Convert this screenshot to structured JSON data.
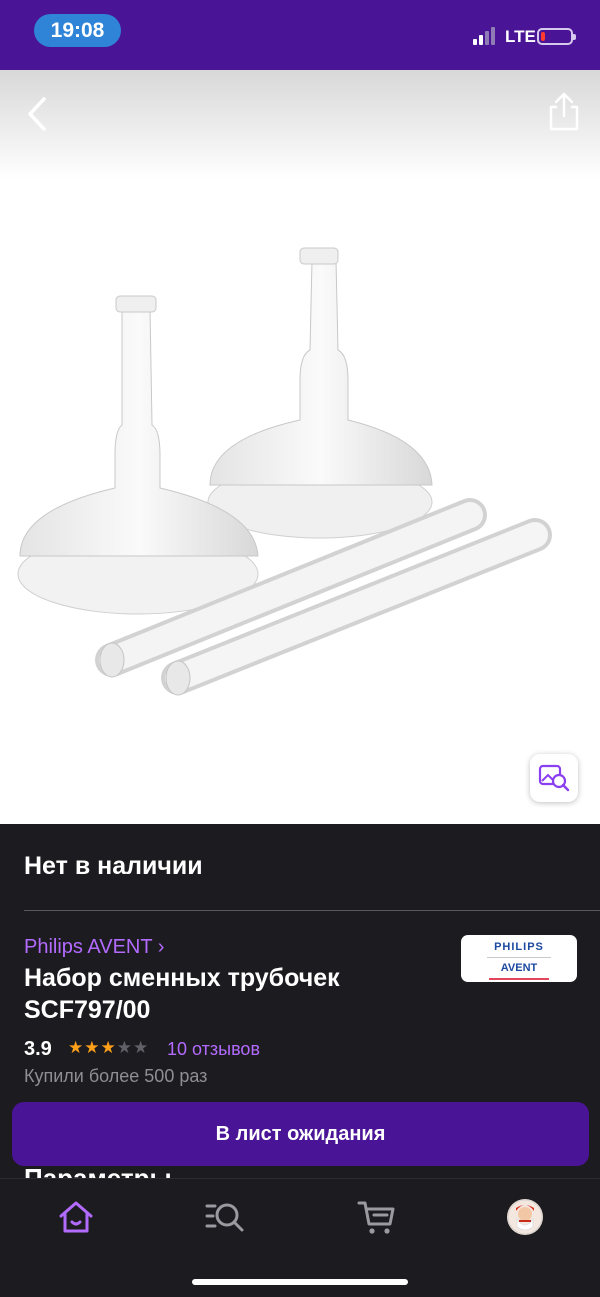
{
  "status_bar": {
    "time": "19:08",
    "network": "LTE",
    "battery_level": 0.15
  },
  "product_image": {
    "back_icon": "chevron-left-icon",
    "share_icon": "share-icon",
    "photo_search_icon": "image-search-icon"
  },
  "product": {
    "stock_status": "Нет в наличии",
    "brand": "Philips AVENT ›",
    "brand_logo": {
      "line1": "PHILIPS",
      "line2": "AVENT"
    },
    "title": "Набор сменных трубочек SCF797/00",
    "rating": "3.9",
    "rating_value": 3.9,
    "stars_max": 5,
    "reviews": "10 отзывов",
    "bought": "Купили более 500 раз"
  },
  "sections": {
    "params_title": "Параметры"
  },
  "actions": {
    "waitlist_label": "В лист ожидания"
  },
  "tab_bar": {
    "tabs": [
      {
        "name": "home",
        "icon": "home-icon",
        "active": true
      },
      {
        "name": "catalog",
        "icon": "search-catalog-icon",
        "active": false
      },
      {
        "name": "cart",
        "icon": "cart-icon",
        "active": false
      },
      {
        "name": "profile",
        "icon": "avatar",
        "active": false
      }
    ]
  },
  "colors": {
    "brand_purple": "#4a1496",
    "accent_link": "#b36bff",
    "star": "#ff9f1a",
    "background": "#1c1b1f"
  }
}
